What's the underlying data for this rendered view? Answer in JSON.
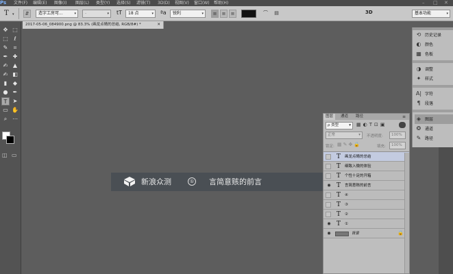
{
  "app": {
    "logo": "Ps"
  },
  "menu": [
    "文件(F)",
    "编辑(E)",
    "图像(I)",
    "图层(L)",
    "类型(Y)",
    "选择(S)",
    "滤镜(T)",
    "3D(D)",
    "视图(V)",
    "窗口(W)",
    "帮助(H)"
  ],
  "window_controls": [
    "–",
    "□",
    "✕"
  ],
  "options": {
    "tool_icon": "T",
    "font_family": "造字工房可...",
    "font_style": "-",
    "font_size": "18 点",
    "antialias": "锐利",
    "mode_3d": "3D",
    "workspace": "基本功能"
  },
  "document": {
    "tab_title": "2017-05-06_084900.png @ 83.3% (画龙点睛的总结, RGB/8#) *",
    "close": "✕"
  },
  "dock": [
    {
      "icon": "history-icon",
      "glyph": "⟲",
      "label": "历史记录"
    },
    {
      "icon": "color-icon",
      "glyph": "◐",
      "label": "颜色"
    },
    {
      "icon": "swatches-icon",
      "glyph": "▦",
      "label": "色板"
    },
    {
      "icon": "adjustments-icon",
      "glyph": "◑",
      "label": "调整"
    },
    {
      "icon": "styles-icon",
      "glyph": "✦",
      "label": "样式"
    },
    {
      "icon": "character-icon",
      "glyph": "A|",
      "label": "字符"
    },
    {
      "icon": "paragraph-icon",
      "glyph": "¶",
      "label": "段落"
    },
    {
      "icon": "layers-icon",
      "glyph": "◈",
      "label": "图层"
    },
    {
      "icon": "channels-icon",
      "glyph": "❂",
      "label": "通道"
    },
    {
      "icon": "paths-icon",
      "glyph": "✎",
      "label": "路径"
    }
  ],
  "layers_panel": {
    "tabs": [
      "图层",
      "通道",
      "路径"
    ],
    "filter_kind": "ρ 类型",
    "blend_mode": "正常",
    "opacity_label": "不透明度:",
    "opacity_value": "100%",
    "lock_label": "锁定:",
    "fill_label": "填充:",
    "fill_value": "100%",
    "layers": [
      {
        "name": "画龙点睛的总结",
        "type": "text",
        "visible": false,
        "selected": true
      },
      {
        "name": "细致入微的体验",
        "type": "text",
        "visible": false,
        "selected": false
      },
      {
        "name": "个性十足的开箱",
        "type": "text",
        "visible": false,
        "selected": false
      },
      {
        "name": "言简意赅的前言",
        "type": "text",
        "visible": true,
        "selected": false
      },
      {
        "name": "④",
        "type": "text",
        "visible": false,
        "selected": false
      },
      {
        "name": "③",
        "type": "text",
        "visible": false,
        "selected": false
      },
      {
        "name": "②",
        "type": "text",
        "visible": false,
        "selected": false
      },
      {
        "name": "①",
        "type": "text",
        "visible": true,
        "selected": false
      },
      {
        "name": "背景",
        "type": "background",
        "visible": true,
        "selected": false
      }
    ]
  },
  "banner": {
    "brand": "新浪众测",
    "index": "①",
    "heading": "言简意赅的前言"
  }
}
